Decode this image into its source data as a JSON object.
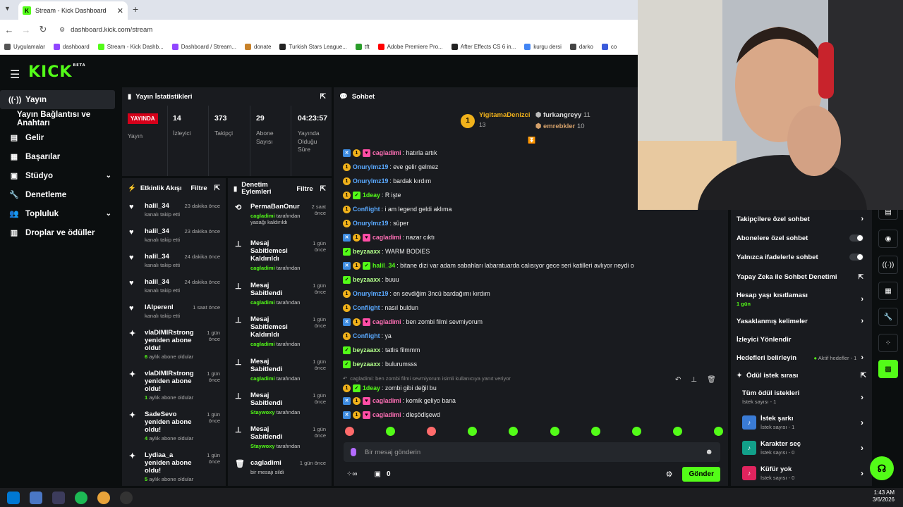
{
  "browser": {
    "tab_title": "Stream - Kick Dashboard",
    "url": "dashboard.kick.com/stream",
    "bookmarks": [
      {
        "label": "Uygulamalar",
        "color": "#555555"
      },
      {
        "label": "dashboard",
        "color": "#9146ff"
      },
      {
        "label": "Stream - Kick Dashb...",
        "color": "#53fc18"
      },
      {
        "label": "Dashboard / Stream...",
        "color": "#9146ff"
      },
      {
        "label": "donate",
        "color": "#c8822a"
      },
      {
        "label": "Turkish Stars League...",
        "color": "#222222"
      },
      {
        "label": "tft",
        "color": "#2a9d2a"
      },
      {
        "label": "Adobe Premiere Pro...",
        "color": "#ff0000"
      },
      {
        "label": "After Effects CS 6 in...",
        "color": "#222222"
      },
      {
        "label": "kurgu dersi",
        "color": "#4285f4"
      },
      {
        "label": "darko",
        "color": "#444444"
      },
      {
        "label": "co",
        "color": "#3b5bdb"
      }
    ]
  },
  "brand": {
    "logo": "KICK",
    "beta": "BETA",
    "accent": "#53fc18"
  },
  "sidebar": [
    {
      "label": "Yayın",
      "icon": "broadcast-icon",
      "active": true
    },
    {
      "label": "Yayın Bağlantısı ve Anahtarı",
      "icon": "",
      "active": false
    },
    {
      "label": "Gelir",
      "icon": "wallet-icon",
      "active": false
    },
    {
      "label": "Başarılar",
      "icon": "trophy-icon",
      "active": false
    },
    {
      "label": "Stüdyo",
      "icon": "studio-icon",
      "active": false,
      "chevron": true
    },
    {
      "label": "Denetleme",
      "icon": "wrench-icon",
      "active": false
    },
    {
      "label": "Topluluk",
      "icon": "people-icon",
      "active": false,
      "chevron": true
    },
    {
      "label": "Droplar ve ödüller",
      "icon": "gift-icon",
      "active": false
    }
  ],
  "stats": {
    "title": "Yayın İstatistikleri",
    "live": "YAYINDA",
    "live_label": "Yayın",
    "items": [
      {
        "value": "14",
        "label": "İzleyici"
      },
      {
        "value": "373",
        "label": "Takipçi"
      },
      {
        "value": "29",
        "label": "Abone Sayısı"
      },
      {
        "value": "04:23:57",
        "label": "Yayında Olduğu Süre"
      }
    ]
  },
  "activity": {
    "title": "Etkinlik Akışı",
    "filter": "Filtre",
    "items": [
      {
        "name": "halil_34",
        "sub": "kanalı takip etti",
        "time": "23 dakika önce",
        "icon": "heart"
      },
      {
        "name": "halil_34",
        "sub": "kanalı takip etti",
        "time": "23 dakika önce",
        "icon": "heart"
      },
      {
        "name": "halil_34",
        "sub": "kanalı takip etti",
        "time": "24 dakika önce",
        "icon": "heart"
      },
      {
        "name": "halil_34",
        "sub": "kanalı takip etti",
        "time": "24 dakika önce",
        "icon": "heart"
      },
      {
        "name": "lAlperenl",
        "sub": "kanalı takip etti",
        "time": "1 saat önce",
        "icon": "heart"
      },
      {
        "name": "vlaDIMIRstrong yeniden abone oldu!",
        "sub_num": "6",
        "sub": "aylık abone oldular",
        "time": "1 gün önce",
        "icon": "star"
      },
      {
        "name": "vlaDIMIRstrong yeniden abone oldu!",
        "sub_num": "1",
        "sub": "aylık abone oldular",
        "time": "1 gün önce",
        "icon": "star"
      },
      {
        "name": "SadeSevo yeniden abone oldu!",
        "sub_num": "4",
        "sub": "aylık abone oldular",
        "time": "1 gün önce",
        "icon": "star"
      },
      {
        "name": "Lydiaa_a yeniden abone oldu!",
        "sub_num": "5",
        "sub": "aylık abone oldular",
        "time": "1 gün önce",
        "icon": "star"
      }
    ]
  },
  "moderation": {
    "title": "Denetim Eylemleri",
    "filter": "Filtre",
    "items": [
      {
        "title": "PermaBanOnur",
        "by": "cagladimi",
        "sub": "tarafından yasağı kaldırıldı",
        "time": "2 saat önce",
        "icon": "undo"
      },
      {
        "title": "Mesaj Sabitlemesi Kaldırıldı",
        "by": "cagladimi",
        "sub": "tarafından",
        "time": "1 gün önce",
        "icon": "pin"
      },
      {
        "title": "Mesaj Sabitlendi",
        "by": "cagladimi",
        "sub": "tarafından",
        "time": "1 gün önce",
        "icon": "pin"
      },
      {
        "title": "Mesaj Sabitlemesi Kaldırıldı",
        "by": "cagladimi",
        "sub": "tarafından",
        "time": "1 gün önce",
        "icon": "pin"
      },
      {
        "title": "Mesaj Sabitlendi",
        "by": "cagladimi",
        "sub": "tarafından",
        "time": "1 gün önce",
        "icon": "pin"
      },
      {
        "title": "Mesaj Sabitlendi",
        "by": "Staywoxy",
        "sub": "tarafından",
        "time": "1 gün önce",
        "icon": "pin"
      },
      {
        "title": "Mesaj Sabitlendi",
        "by": "Staywoxy",
        "sub": "tarafından",
        "time": "1 gün önce",
        "icon": "pin"
      },
      {
        "title": "cagladimi",
        "by": "",
        "sub": "bir mesajı sildi",
        "time": "1 gün önce",
        "icon": "trash"
      }
    ]
  },
  "chat": {
    "title": "Sohbet",
    "leaders": [
      {
        "name": "YigitamaDenizci",
        "count": "13",
        "rank": "1"
      },
      {
        "name": "furkangreyy",
        "count": "11",
        "rank": "2"
      },
      {
        "name": "emrebkler",
        "count": "10",
        "rank": "3"
      }
    ],
    "messages": [
      {
        "badges": [
          "vip",
          "gold",
          "pink"
        ],
        "user": "cagladimi",
        "color": "#ff6fb5",
        "text": "hatırla artık"
      },
      {
        "badges": [
          "gold"
        ],
        "user": "Onurylmz19",
        "color": "#5aa9ff",
        "text": "eve gelir gelmez"
      },
      {
        "badges": [
          "gold"
        ],
        "user": "Onurylmz19",
        "color": "#5aa9ff",
        "text": "bardak kırdım"
      },
      {
        "badges": [
          "gold",
          "green"
        ],
        "user": "1deay",
        "color": "#53fc18",
        "text": "R işte"
      },
      {
        "badges": [
          "gold"
        ],
        "user": "Conflight",
        "color": "#5aa9ff",
        "text": "i am legend geldi aklıma"
      },
      {
        "badges": [
          "gold"
        ],
        "user": "Onurylmz19",
        "color": "#5aa9ff",
        "text": "süper"
      },
      {
        "badges": [
          "vip",
          "gold",
          "pink"
        ],
        "user": "cagladimi",
        "color": "#ff6fb5",
        "text": "nazar cıktı"
      },
      {
        "badges": [
          "green"
        ],
        "user": "beyzaaxx",
        "color": "#b2ff8a",
        "text": "WARM BODIES"
      },
      {
        "badges": [
          "vip",
          "gold",
          "green"
        ],
        "user": "halil_34",
        "color": "#53fc18",
        "text": "bitane dizi var adam sabahları labaratuarda calısıyor gece seri katilleri avlıyor neydi o"
      },
      {
        "badges": [
          "green"
        ],
        "user": "beyzaaxx",
        "color": "#b2ff8a",
        "text": "buuu"
      },
      {
        "badges": [
          "gold"
        ],
        "user": "Onurylmz19",
        "color": "#5aa9ff",
        "text": "en sevdiğim 3ncü bardağımı kırdım"
      },
      {
        "badges": [
          "gold"
        ],
        "user": "Conflight",
        "color": "#5aa9ff",
        "text": "nasıl buldun"
      },
      {
        "badges": [
          "vip",
          "gold",
          "pink"
        ],
        "user": "cagladimi",
        "color": "#ff6fb5",
        "text": "ben zombi filmi sevmiyorum"
      },
      {
        "badges": [
          "gold"
        ],
        "user": "Conflight",
        "color": "#5aa9ff",
        "text": "ya"
      },
      {
        "badges": [
          "green"
        ],
        "user": "beyzaaxx",
        "color": "#b2ff8a",
        "text": "tatlıs filmmm"
      },
      {
        "badges": [
          "green"
        ],
        "user": "beyzaaxx",
        "color": "#b2ff8a",
        "text": "bulurumsss"
      }
    ],
    "reply_to": "cagladimi: ben zombi filmi sevmiyorum isimli kullanıcıya yanıt veriyor",
    "reply_msg": {
      "badges": [
        "gold",
        "green"
      ],
      "user": "1deay",
      "color": "#53fc18",
      "text": "zombi gibi değil bu"
    },
    "after": [
      {
        "badges": [
          "vip",
          "gold",
          "pink"
        ],
        "user": "cagladimi",
        "color": "#ff6fb5",
        "text": "komik geliyo bana"
      },
      {
        "badges": [
          "vip",
          "gold",
          "pink"
        ],
        "user": "cagladimi",
        "color": "#ff6fb5",
        "text": "dleşödlşewd"
      }
    ],
    "placeholder": "Bir mesaj gönderin",
    "points": "0",
    "send": "Gönder"
  },
  "settings": {
    "rows": [
      {
        "label": "Takipçilere özel sohbet",
        "type": "arrow"
      },
      {
        "label": "Abonelere özel sohbet",
        "type": "toggle"
      },
      {
        "label": "Yalnızca ifadelerle sohbet",
        "type": "toggle"
      },
      {
        "label": "Yapay Zeka ile Sohbet Denetimi",
        "type": "external"
      },
      {
        "label": "Hesap yaşı kısıtlaması",
        "sub": "1 gün",
        "type": "arrow"
      },
      {
        "label": "Yasaklanmış kelimeler",
        "type": "arrow"
      },
      {
        "label": "İzleyici Yönlendir",
        "type": "none"
      },
      {
        "label": "Hedefleri belirleyin",
        "extra": "Aktif hedefler - 1",
        "type": "arrow"
      }
    ]
  },
  "rewards": {
    "title": "Ödül istek sırası",
    "items": [
      {
        "label": "Tüm ödül istekleri",
        "sub": "İstek sayısı - 1",
        "icon": "",
        "color": ""
      },
      {
        "label": "İstek şarkı",
        "sub": "İstek sayısı - 1",
        "icon": "music-icon",
        "color": "#3a7bd5"
      },
      {
        "label": "Karakter seç",
        "sub": "İstek sayısı - 0",
        "icon": "character-icon",
        "color": "#12a08a"
      },
      {
        "label": "Küfür yok",
        "sub": "İstek sayısı - 0",
        "icon": "nocurse-icon",
        "color": "#e0245e"
      }
    ]
  },
  "taskbar": {
    "time": "1:43 AM",
    "date": "3/6/2026"
  }
}
